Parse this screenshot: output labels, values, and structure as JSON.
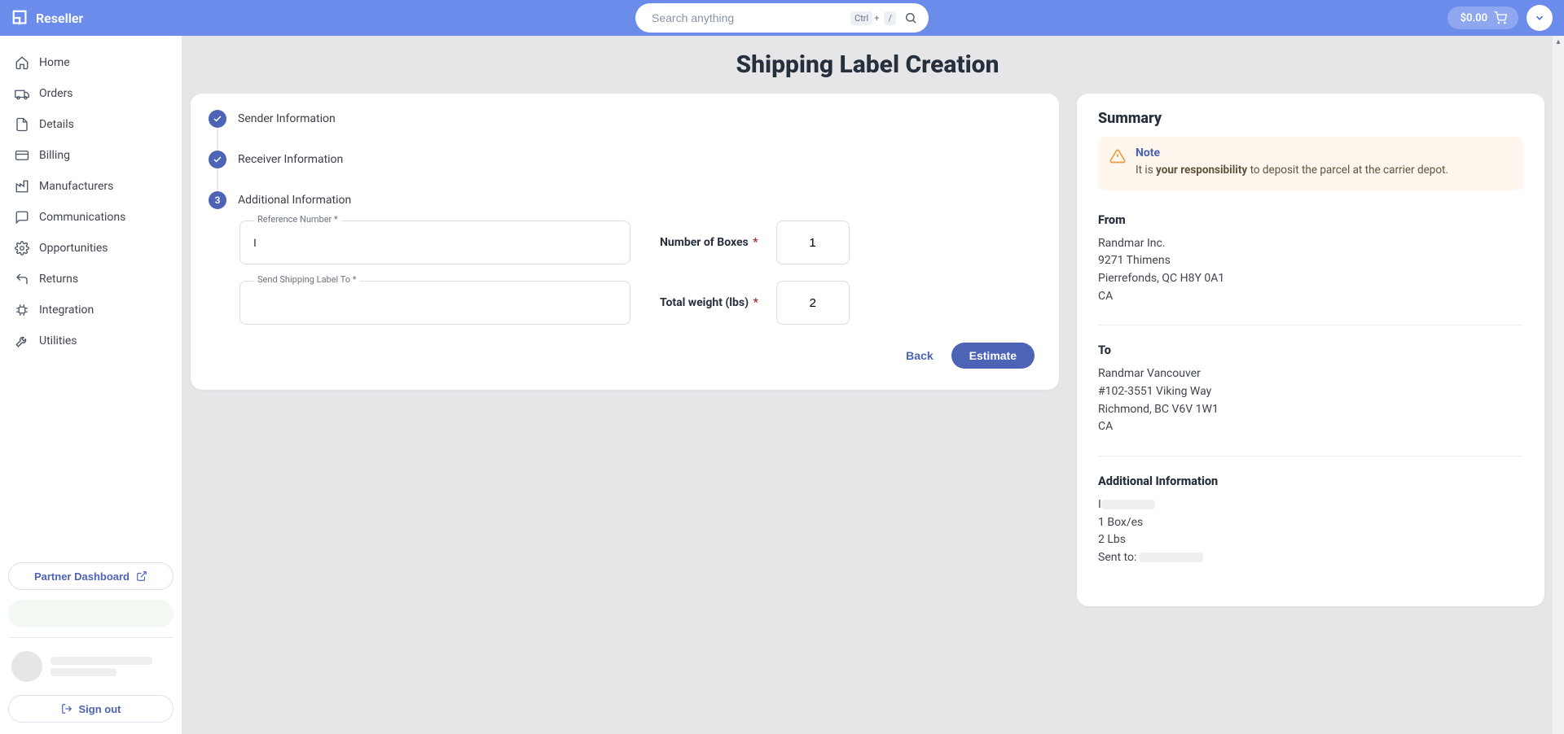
{
  "header": {
    "brand": "Reseller",
    "search_placeholder": "Search anything",
    "shortcut_ctrl": "Ctrl",
    "shortcut_plus": "+",
    "shortcut_slash": "/",
    "balance": "$0.00"
  },
  "sidebar": {
    "items": [
      {
        "label": "Home",
        "icon": "home-icon"
      },
      {
        "label": "Orders",
        "icon": "orders-icon"
      },
      {
        "label": "Details",
        "icon": "details-icon"
      },
      {
        "label": "Billing",
        "icon": "billing-icon"
      },
      {
        "label": "Manufacturers",
        "icon": "manufacturers-icon"
      },
      {
        "label": "Communications",
        "icon": "communications-icon"
      },
      {
        "label": "Opportunities",
        "icon": "opportunities-icon"
      },
      {
        "label": "Returns",
        "icon": "returns-icon"
      },
      {
        "label": "Integration",
        "icon": "integration-icon"
      },
      {
        "label": "Utilities",
        "icon": "utilities-icon"
      }
    ],
    "partner_dashboard_label": "Partner Dashboard",
    "sign_out_label": "Sign out"
  },
  "page": {
    "title": "Shipping Label Creation"
  },
  "stepper": {
    "step1_label": "Sender Information",
    "step2_label": "Receiver Information",
    "step3_label": "Additional Information",
    "step3_number": "3"
  },
  "form": {
    "reference_label": "Reference Number *",
    "reference_value": "I",
    "send_label": "Send Shipping Label To *",
    "send_value": "",
    "boxes_label": "Number of Boxes",
    "boxes_value": "1",
    "weight_label": "Total weight (lbs)",
    "weight_value": "2",
    "back_label": "Back",
    "estimate_label": "Estimate"
  },
  "summary": {
    "title": "Summary",
    "note_title": "Note",
    "note_prefix": "It is ",
    "note_bold": "your responsibility",
    "note_suffix": " to deposit the parcel at the carrier depot.",
    "from_label": "From",
    "from_name": "Randmar Inc.",
    "from_street": "9271 Thimens",
    "from_city": "Pierrefonds, QC H8Y 0A1",
    "from_country": "CA",
    "to_label": "To",
    "to_name": "Randmar Vancouver",
    "to_street": "#102-3551 Viking Way",
    "to_city": "Richmond, BC V6V 1W1",
    "to_country": "CA",
    "addl_label": "Additional Information",
    "addl_ref_prefix": "I",
    "addl_boxes": "1 Box/es",
    "addl_weight": "2 Lbs",
    "addl_sent_prefix": "Sent to: "
  }
}
